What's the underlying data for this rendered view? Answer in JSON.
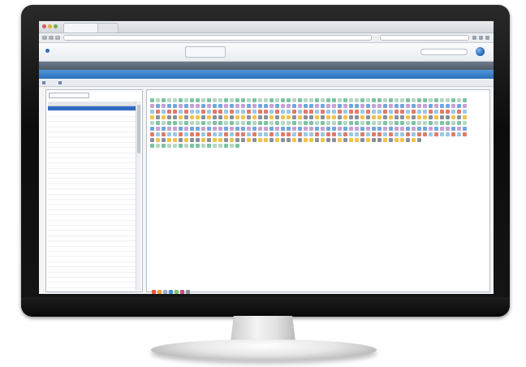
{
  "browser": {
    "window_title": "",
    "tabs": [
      "",
      ""
    ],
    "url": "",
    "search_placeholder": ""
  },
  "app": {
    "logo_text": "",
    "toolbox_lines": [
      "",
      ""
    ],
    "search_placeholder": "",
    "menu": [
      "",
      "",
      "",
      "",
      "",
      "",
      "",
      ""
    ],
    "section_title": "",
    "subtoolbar": [
      "",
      ""
    ],
    "left_panel": {
      "dropdown_value": "",
      "columns": [
        "",
        "",
        ""
      ],
      "rows": [
        [
          "",
          "",
          ""
        ],
        [
          "",
          "",
          ""
        ],
        [
          "",
          "",
          ""
        ],
        [
          "",
          "",
          ""
        ],
        [
          "",
          "",
          ""
        ],
        [
          "",
          "",
          ""
        ],
        [
          "",
          "",
          ""
        ],
        [
          "",
          "",
          ""
        ],
        [
          "",
          "",
          ""
        ],
        [
          "",
          "",
          ""
        ],
        [
          "",
          "",
          ""
        ],
        [
          "",
          "",
          ""
        ],
        [
          "",
          "",
          ""
        ],
        [
          "",
          "",
          ""
        ],
        [
          "",
          "",
          ""
        ],
        [
          "",
          "",
          ""
        ],
        [
          "",
          "",
          ""
        ],
        [
          "",
          "",
          ""
        ],
        [
          "",
          "",
          ""
        ],
        [
          "",
          "",
          ""
        ],
        [
          "",
          "",
          ""
        ],
        [
          "",
          "",
          ""
        ],
        [
          "",
          "",
          ""
        ],
        [
          "",
          "",
          ""
        ],
        [
          "",
          "",
          ""
        ],
        [
          "",
          "",
          ""
        ],
        [
          "",
          "",
          ""
        ],
        [
          "",
          "",
          ""
        ],
        [
          "",
          "",
          ""
        ],
        [
          "",
          "",
          ""
        ],
        [
          "",
          "",
          ""
        ],
        [
          "",
          "",
          ""
        ],
        [
          "",
          "",
          ""
        ],
        [
          "",
          "",
          ""
        ],
        [
          "",
          "",
          ""
        ],
        [
          "",
          "",
          ""
        ],
        [
          "",
          "",
          ""
        ],
        [
          "",
          "",
          ""
        ],
        [
          "",
          "",
          ""
        ],
        [
          "",
          "",
          ""
        ],
        [
          "",
          "",
          ""
        ]
      ],
      "selected_row": 0
    },
    "right_panel": {
      "label": "",
      "legend": [
        "",
        "",
        "",
        "",
        "",
        "",
        "",
        "",
        ""
      ],
      "footer_text": "",
      "grid_colors": [
        "#7cc4a0",
        "#6fa8dc",
        "#9bc7e6",
        "#8a8f99",
        "#b6d7c2",
        "#c7a0d6",
        "#e07a6a",
        "#f2c14e"
      ],
      "footer_icon_colors": [
        "#e05a4a",
        "#f0a030",
        "#9ab0d0",
        "#4a90d9",
        "#7cc46a",
        "#d04a8a",
        "#8a8f99"
      ]
    }
  }
}
